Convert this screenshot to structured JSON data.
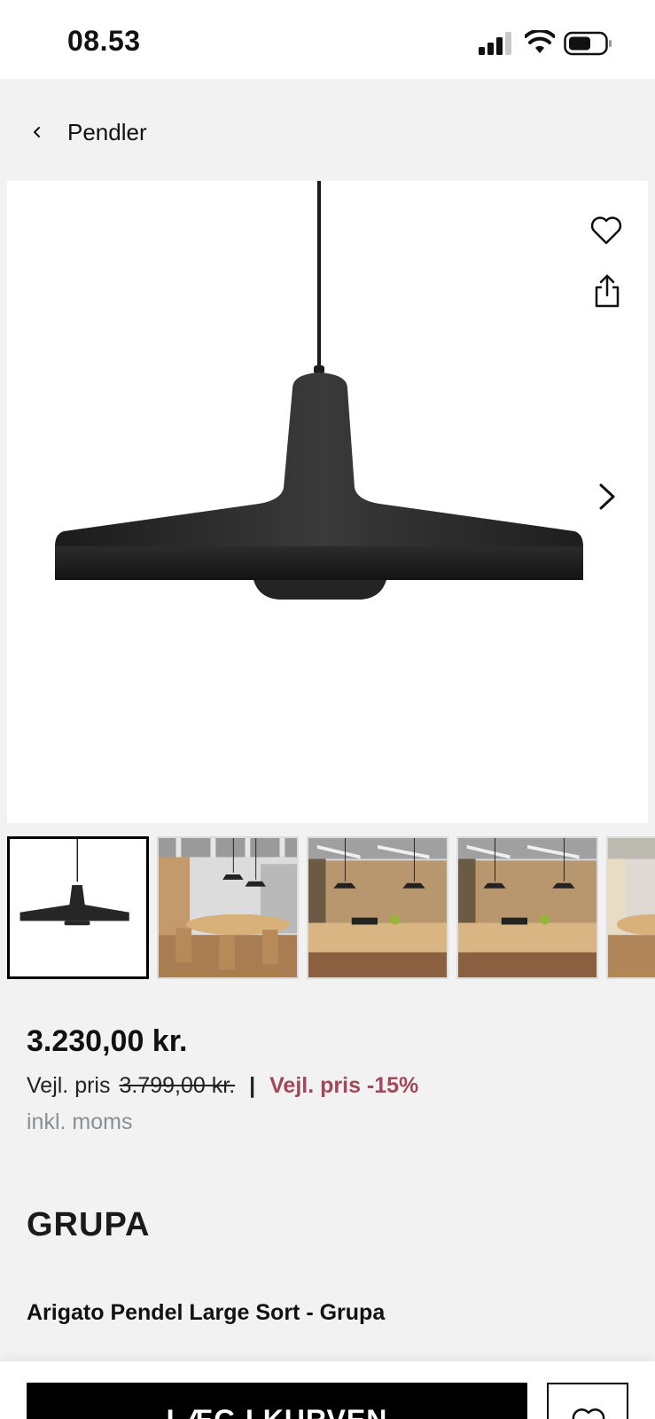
{
  "status_bar": {
    "time": "08.53"
  },
  "nav": {
    "back_label": "Pendler"
  },
  "product": {
    "price": "3.230,00 kr.",
    "rrp_label": "Vejl. pris",
    "rrp_old": "3.799,00 kr.",
    "separator": "|",
    "discount": "Vejl. pris -15%",
    "vat_note": "inkl. moms",
    "brand": "GRUPA",
    "title": "Arigato Pendel Large Sort - Grupa"
  },
  "gallery": {
    "thumbnails": [
      "pendant-lamp-cutout",
      "dining-room-scene-1",
      "dining-room-scene-2",
      "dining-room-scene-3",
      "dining-room-scene-4"
    ],
    "active_index": 0
  },
  "actions": {
    "add_to_cart": "LÆG I KURVEN"
  },
  "icons": {
    "back": "chevron-left-icon",
    "favorite": "heart-icon",
    "share": "share-icon",
    "next": "chevron-right-icon",
    "wishlist": "heart-icon"
  },
  "colors": {
    "discount": "#a3485a",
    "button": "#000000",
    "background": "#f2f2f2"
  }
}
